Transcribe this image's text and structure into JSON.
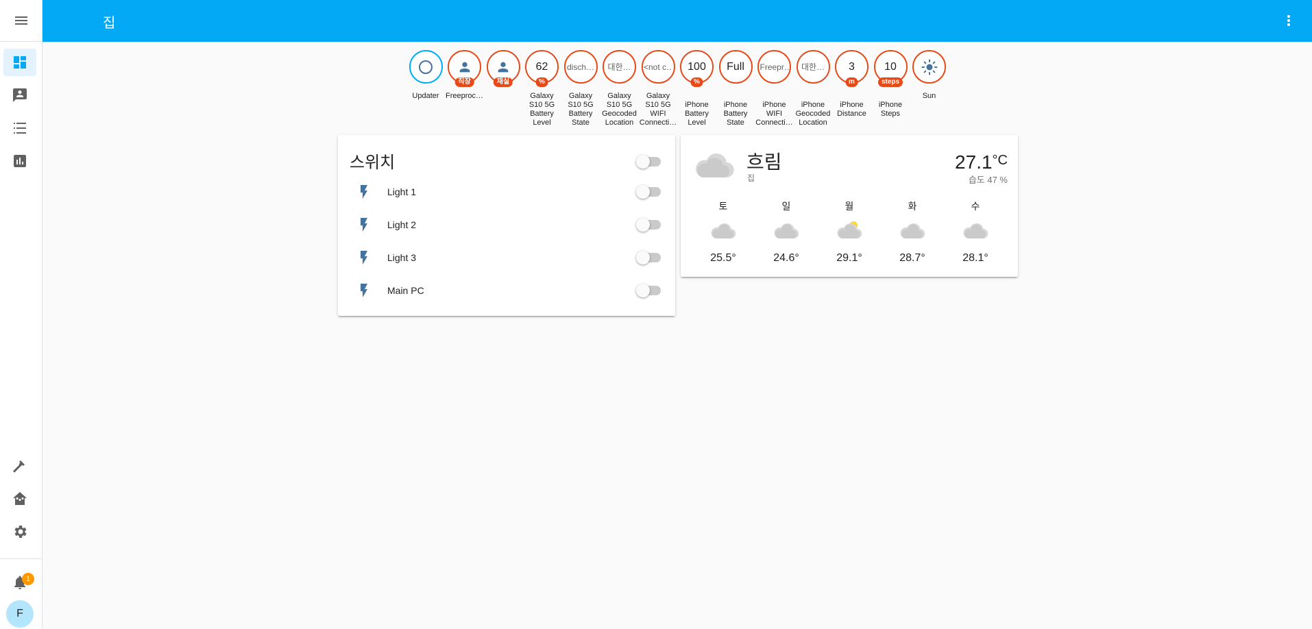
{
  "header": {
    "title": "집"
  },
  "sidebar": {
    "items": [
      {
        "name": "overview",
        "icon": "dashboard-icon"
      },
      {
        "name": "logbook",
        "icon": "logbook-icon"
      },
      {
        "name": "history",
        "icon": "history-icon"
      },
      {
        "name": "energy",
        "icon": "chart-icon"
      }
    ],
    "bottom": [
      "developer-tools-icon",
      "supervisor-icon",
      "settings-icon"
    ],
    "notification_count": "1",
    "user_initial": "F"
  },
  "badges": [
    {
      "value": "",
      "unit": "",
      "label": "Updater",
      "type": "icon"
    },
    {
      "value": "",
      "unit": "직장",
      "label": "Freeproc…",
      "type": "person"
    },
    {
      "value": "",
      "unit": "재실",
      "label": "",
      "type": "person"
    },
    {
      "value": "62",
      "unit": "%",
      "label": "Galaxy S10 5G Battery Level",
      "type": "value"
    },
    {
      "value": "disch…",
      "unit": "",
      "label": "Galaxy S10 5G Battery State",
      "type": "text"
    },
    {
      "value": "대한…",
      "unit": "",
      "label": "Galaxy S10 5G Geocoded Location",
      "type": "text"
    },
    {
      "value": "<not c…",
      "unit": "",
      "label": "Galaxy S10 5G WIFI Connecti…",
      "type": "text"
    },
    {
      "value": "100",
      "unit": "%",
      "label": "iPhone Battery Level",
      "type": "value"
    },
    {
      "value": "Full",
      "unit": "",
      "label": "iPhone Battery State",
      "type": "value"
    },
    {
      "value": "Freepr…",
      "unit": "",
      "label": "iPhone WIFI Connecti…",
      "type": "text"
    },
    {
      "value": "대한…",
      "unit": "",
      "label": "iPhone Geocoded Location",
      "type": "text"
    },
    {
      "value": "3",
      "unit": "m",
      "label": "iPhone Distance",
      "type": "value"
    },
    {
      "value": "10",
      "unit": "steps",
      "label": "iPhone Steps",
      "type": "value"
    },
    {
      "value": "",
      "unit": "",
      "label": "Sun",
      "type": "sun"
    }
  ],
  "switches": {
    "title": "스위치",
    "items": [
      {
        "label": "Light 1",
        "on": false
      },
      {
        "label": "Light 2",
        "on": false
      },
      {
        "label": "Light 3",
        "on": false
      },
      {
        "label": "Main PC",
        "on": false
      }
    ]
  },
  "weather": {
    "condition": "흐림",
    "location": "집",
    "temperature": "27.1",
    "temp_unit": "°C",
    "humidity": "습도 47 %",
    "forecast": [
      {
        "day": "토",
        "temp": "25.5°",
        "icon": "cloudy-icon"
      },
      {
        "day": "일",
        "temp": "24.6°",
        "icon": "cloudy-icon"
      },
      {
        "day": "월",
        "temp": "29.1°",
        "icon": "partly-sunny-icon"
      },
      {
        "day": "화",
        "temp": "28.7°",
        "icon": "cloudy-icon"
      },
      {
        "day": "수",
        "temp": "28.1°",
        "icon": "cloudy-icon"
      }
    ]
  },
  "colors": {
    "primary": "#03a9f4",
    "badge": "#e64a19",
    "icon": "#44739e",
    "sun": "#fdd835"
  }
}
